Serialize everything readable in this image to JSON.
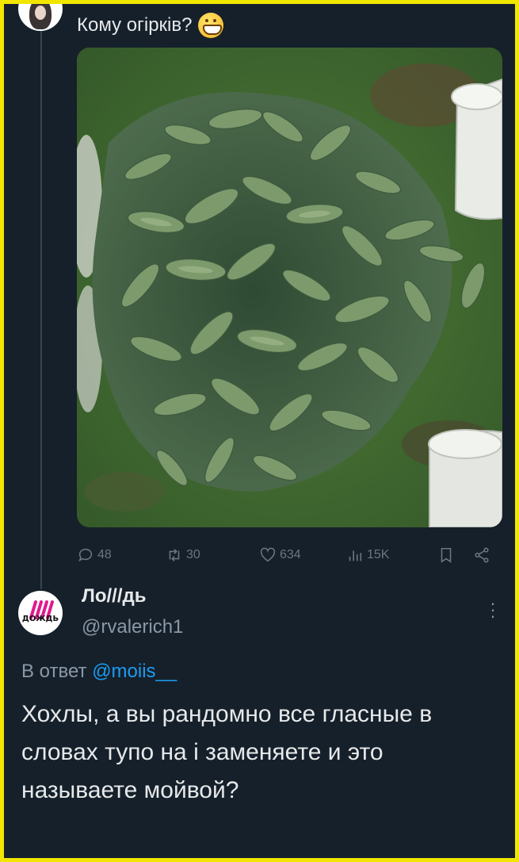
{
  "tweet": {
    "text": "Кому огірків?",
    "emoji_icon": "grinning-face-emoji",
    "stats": {
      "replies": "48",
      "retweets": "30",
      "likes": "634",
      "views": "15K"
    }
  },
  "reply": {
    "display_name": "Ло///дь",
    "handle": "@rvalerich1",
    "avatar_logo_text": "ДОЖДЬ",
    "reply_to_prefix": "В ответ",
    "reply_to_handle": "@moiis__",
    "text": "Хохлы, а вы рандомно все гласные в словах тупо на і заменяете и это называете мойвой?"
  },
  "colors": {
    "background": "#15202b",
    "border": "#f2e600",
    "primary_text": "#e7e9ea",
    "secondary_text": "#8b98a5",
    "link": "#1d9bf0"
  }
}
